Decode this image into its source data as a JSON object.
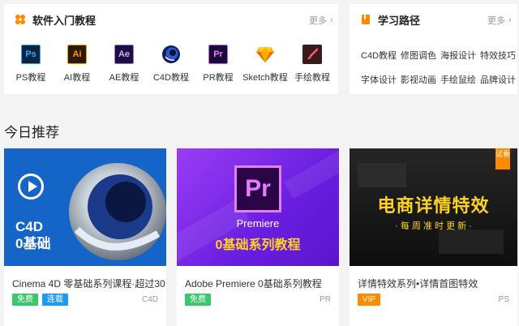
{
  "software_panel": {
    "title": "软件入门教程",
    "more": "更多",
    "items": [
      {
        "label": "PS教程",
        "glyph": "Ps",
        "icon": "photoshop-icon",
        "bg": "#0b2540",
        "fg": "#31a8ff"
      },
      {
        "label": "AI教程",
        "glyph": "Ai",
        "icon": "illustrator-icon",
        "bg": "#2d1a05",
        "fg": "#ff9a00"
      },
      {
        "label": "AE教程",
        "glyph": "Ae",
        "icon": "after-effects-icon",
        "bg": "#1c1040",
        "fg": "#d3a8ff"
      },
      {
        "label": "C4D教程",
        "glyph": "",
        "icon": "cinema4d-icon",
        "bg": "#ffffff",
        "fg": "#1b3fa6"
      },
      {
        "label": "PR教程",
        "glyph": "Pr",
        "icon": "premiere-icon",
        "bg": "#1a0a38",
        "fg": "#e77cff"
      },
      {
        "label": "Sketch教程",
        "glyph": "",
        "icon": "sketch-icon",
        "bg": "#ffffff",
        "fg": "#f7a800"
      },
      {
        "label": "手绘教程",
        "glyph": "",
        "icon": "brush-icon",
        "bg": "#3a1a1a",
        "fg": "#ff5a6a"
      }
    ]
  },
  "path_panel": {
    "title": "学习路径",
    "more": "更多",
    "items": [
      "C4D教程",
      "修图调色",
      "海报设计",
      "特效技巧",
      "字体设计",
      "影视动画",
      "手绘鼠绘",
      "品牌设计"
    ]
  },
  "recommend": {
    "title": "今日推荐",
    "cards": [
      {
        "title": "Cinema 4D 零基础系列课程·超过30",
        "tags": [
          {
            "text": "免费",
            "color": "#3cc66e"
          },
          {
            "text": "连载",
            "color": "#1e9bf0"
          }
        ],
        "category": "C4D",
        "thumb_line1": "C4D",
        "thumb_line2": "0基础"
      },
      {
        "title": "Adobe Premiere 0基础系列教程",
        "tags": [
          {
            "text": "免费",
            "color": "#3cc66e"
          }
        ],
        "category": "PR",
        "thumb_word": "Premiere",
        "thumb_line": "0基础系列教程",
        "thumb_glyph": "Pr"
      },
      {
        "title": "详情特效系列•详情首图特效",
        "tags": [
          {
            "text": "VIP",
            "color": "#ff8a00"
          }
        ],
        "category": "PS",
        "thumb_heading": "电商详情特效",
        "thumb_sub": "· 每 周 准 时 更 新 ·",
        "corner_badge": "试看"
      }
    ]
  },
  "colors": {
    "accent": "#ff8a00",
    "card1_bg": "#1565c8",
    "card2_bg": "#7b2cf0",
    "card3_bg": "#141414"
  }
}
